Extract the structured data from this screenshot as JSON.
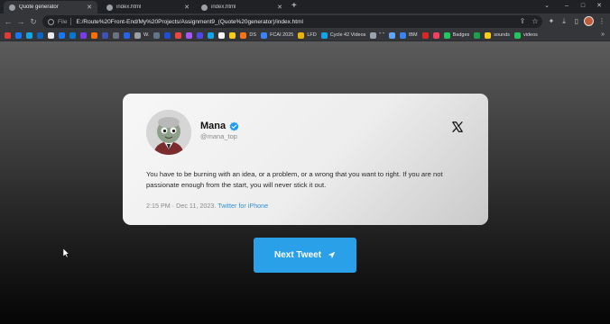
{
  "tabs": [
    {
      "title": "Quote generator",
      "active": true
    },
    {
      "title": "index.html",
      "active": false
    },
    {
      "title": "index.html",
      "active": false
    }
  ],
  "window_controls": {
    "minimize": "–",
    "maximize": "□",
    "close": "✕"
  },
  "address_bar": {
    "scheme": "File",
    "url": "E:/Route%20Front-End/My%20Projects/Assignment9_(Quote%20generator)/index.html"
  },
  "bookmarks": [
    {
      "label": "",
      "color": "#e53935"
    },
    {
      "label": "",
      "color": "#1877f2"
    },
    {
      "label": "",
      "color": "#0ea5e9"
    },
    {
      "label": "",
      "color": "#0a66c2"
    },
    {
      "label": "",
      "color": "#e8eaed"
    },
    {
      "label": "",
      "color": "#1877f2"
    },
    {
      "label": "",
      "color": "#0078d4"
    },
    {
      "label": "",
      "color": "#7c3aed"
    },
    {
      "label": "",
      "color": "#ff6f00"
    },
    {
      "label": "",
      "color": "#3f51b5"
    },
    {
      "label": "",
      "color": "#6b7280"
    },
    {
      "label": "",
      "color": "#2563eb"
    },
    {
      "label": "W.",
      "color": "#9aa0a6"
    },
    {
      "label": "",
      "color": "#64748b"
    },
    {
      "label": "",
      "color": "#1d4ed8"
    },
    {
      "label": "",
      "color": "#ef4444"
    },
    {
      "label": "",
      "color": "#a855f7"
    },
    {
      "label": "",
      "color": "#4f46e5"
    },
    {
      "label": "",
      "color": "#0ea5e9"
    },
    {
      "label": "",
      "color": "#f5f5f5"
    },
    {
      "label": "",
      "color": "#facc15"
    },
    {
      "label": "DS",
      "color": "#f97316"
    },
    {
      "label": "FCAI 2025",
      "color": "#3b82f6"
    },
    {
      "label": "LFD",
      "color": "#eab308"
    },
    {
      "label": "Cycle 42 Videos",
      "color": "#0ea5e9"
    },
    {
      "label": "\" \"",
      "color": "#9ca3af"
    },
    {
      "label": "",
      "color": "#60a5fa"
    },
    {
      "label": "IBM",
      "color": "#3b82f6"
    },
    {
      "label": "",
      "color": "#dc2626"
    },
    {
      "label": "",
      "color": "#f43f5e"
    },
    {
      "label": "Badges",
      "color": "#22c55e"
    },
    {
      "label": "",
      "color": "#16a34a"
    },
    {
      "label": "sounds",
      "color": "#facc15"
    },
    {
      "label": "videos",
      "color": "#22c55e"
    }
  ],
  "bookmarks_more": "»",
  "tweet": {
    "name": "Mana",
    "handle": "@mana_top",
    "text": "You have to be burning with an idea, or a problem, or a wrong that you want to right. If you are not passionate enough from the start, you will never stick it out.",
    "time": "2:15 PM · Dec 11, 2023.",
    "source": "Twitter for iPhone"
  },
  "next_button": {
    "label": "Next Tweet"
  },
  "colors": {
    "accent": "#2aa0e8",
    "verified": "#1d9bf0"
  }
}
